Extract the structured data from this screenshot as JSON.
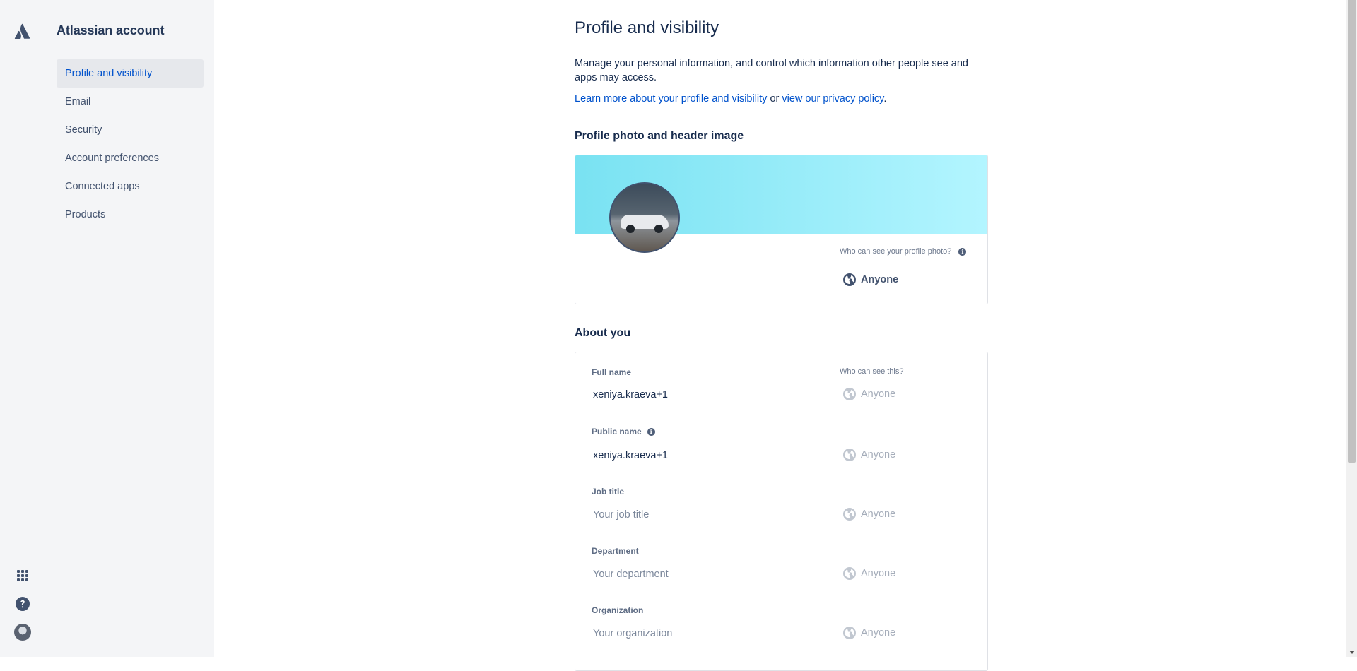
{
  "sidebar": {
    "app_title": "Atlassian account",
    "items": [
      {
        "label": "Profile and visibility"
      },
      {
        "label": "Email"
      },
      {
        "label": "Security"
      },
      {
        "label": "Account preferences"
      },
      {
        "label": "Connected apps"
      },
      {
        "label": "Products"
      }
    ],
    "bottom_icons": [
      "app-switcher-icon",
      "help-icon",
      "user-avatar"
    ]
  },
  "main": {
    "title": "Profile and visibility",
    "intro": "Manage your personal information, and control which information other people see and apps may access.",
    "learn_link": "Learn more about your profile and visibility",
    "or_text": " or ",
    "privacy_link": "view our privacy policy",
    "period": ".",
    "photo_section": {
      "title": "Profile photo and header image",
      "who_label": "Who can see your profile photo?",
      "visibility": "Anyone"
    },
    "about_section": {
      "title": "About you",
      "who_header": "Who can see this?",
      "fields": [
        {
          "label": "Full name",
          "value": "xeniya.kraeva+1",
          "placeholder": "",
          "visibility": "Anyone"
        },
        {
          "label": "Public name",
          "value": "xeniya.kraeva+1",
          "placeholder": "",
          "visibility": "Anyone"
        },
        {
          "label": "Job title",
          "value": "",
          "placeholder": "Your job title",
          "visibility": "Anyone"
        },
        {
          "label": "Department",
          "value": "",
          "placeholder": "Your department",
          "visibility": "Anyone"
        },
        {
          "label": "Organization",
          "value": "",
          "placeholder": "Your organization",
          "visibility": "Anyone"
        }
      ]
    }
  },
  "colors": {
    "link": "#0052cc",
    "sidebar_bg": "#f4f5f7",
    "active_nav_bg": "#e6e8ec",
    "header_gradient_start": "#79e2f2",
    "header_gradient_end": "#b3f5ff"
  }
}
